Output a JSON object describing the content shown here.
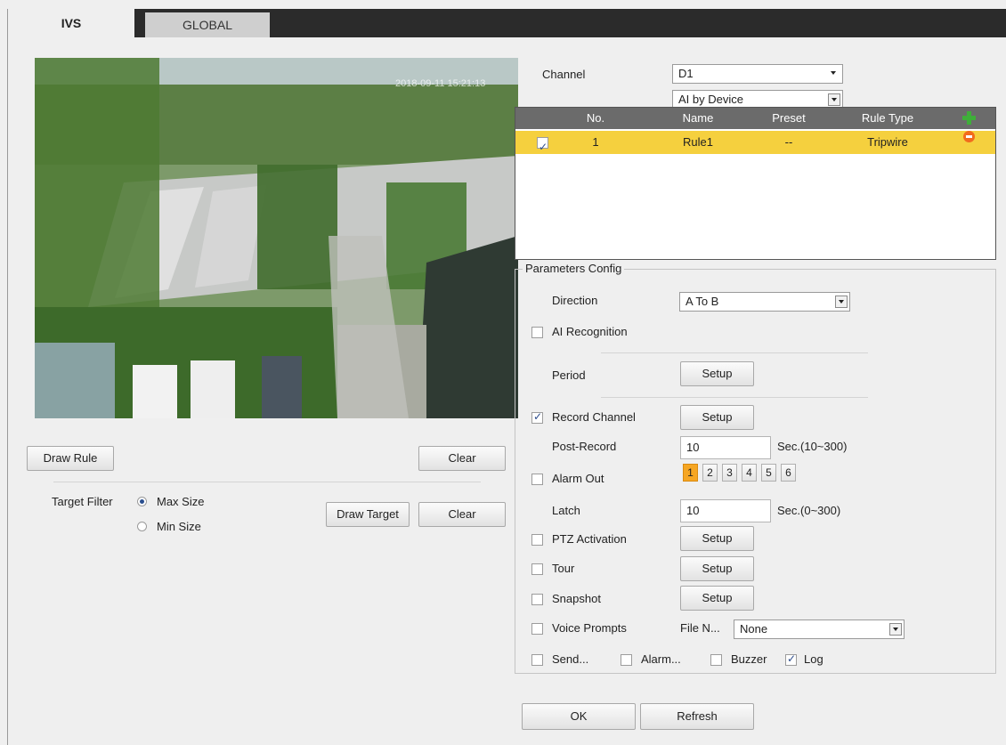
{
  "tabs": [
    {
      "label": "IVS"
    },
    {
      "label": "GLOBAL"
    }
  ],
  "video": {
    "timestamp": "2018-09-11 15:21:13"
  },
  "left": {
    "draw_rule": "Draw Rule",
    "clear": "Clear",
    "target_filter_label": "Target Filter",
    "max_size": "Max Size",
    "min_size": "Min Size",
    "draw_target": "Draw Target",
    "clear_target": "Clear"
  },
  "channel": {
    "label": "Channel",
    "value": "D1",
    "mode": "AI by Device"
  },
  "rules_table": {
    "headers": [
      "No.",
      "Name",
      "Preset",
      "Rule Type"
    ],
    "rows": [
      {
        "checked": true,
        "no": "1",
        "name": "Rule1",
        "preset": "--",
        "rule_type": "Tripwire"
      }
    ]
  },
  "params": {
    "legend": "Parameters Config",
    "direction_label": "Direction",
    "direction_value": "A To B",
    "ai_recognition": "AI Recognition",
    "period": "Period",
    "setup": "Setup",
    "record_channel": "Record Channel",
    "post_record": "Post-Record",
    "post_record_value": "10",
    "post_record_unit": "Sec.(10~300)",
    "alarm_out": "Alarm Out",
    "alarm_outputs": [
      "1",
      "2",
      "3",
      "4",
      "5",
      "6"
    ],
    "latch": "Latch",
    "latch_value": "10",
    "latch_unit": "Sec.(0~300)",
    "ptz_activation": "PTZ Activation",
    "tour": "Tour",
    "snapshot": "Snapshot",
    "voice_prompts": "Voice Prompts",
    "file_name_label": "File N...",
    "file_name_value": "None",
    "send": "Send...",
    "alarm": "Alarm...",
    "buzzer": "Buzzer",
    "log": "Log"
  },
  "footer": {
    "ok": "OK",
    "refresh": "Refresh"
  }
}
